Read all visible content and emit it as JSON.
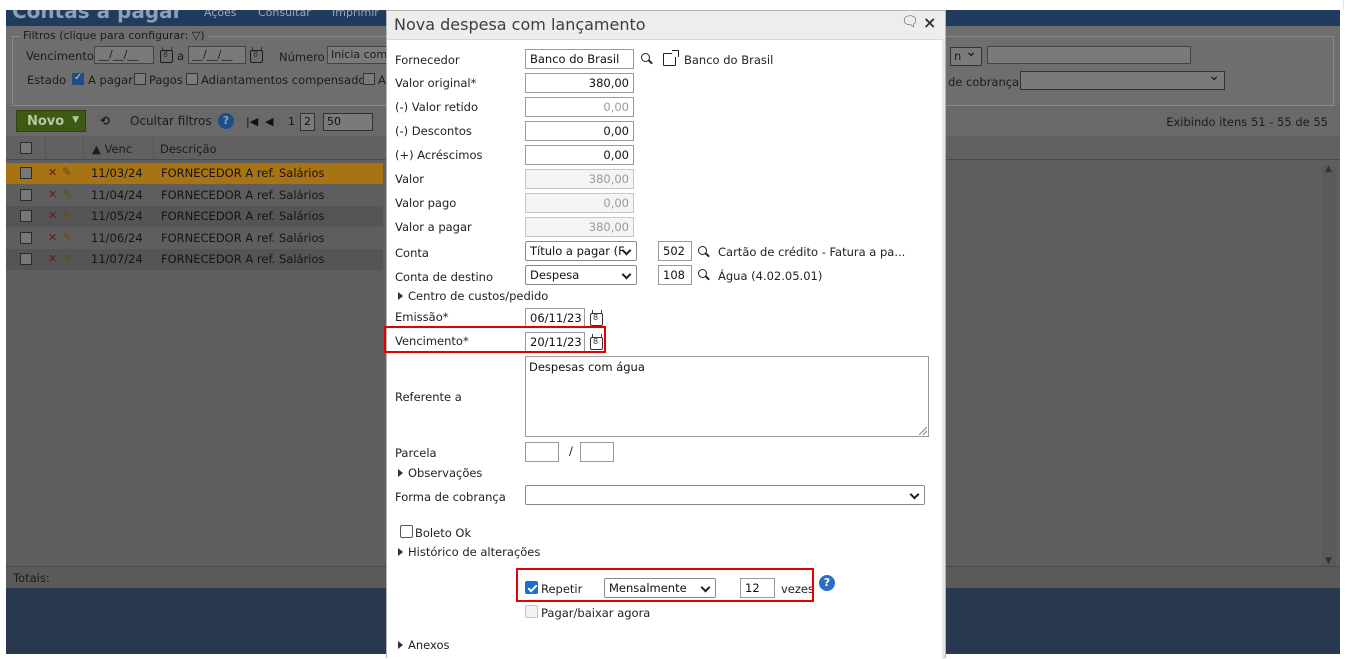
{
  "background": {
    "title": "Contas a pagar",
    "menu": [
      "Ações",
      "Consultar",
      "Imprimir"
    ],
    "filters": {
      "legend": "Filtros (clique para configurar:",
      "vencimento_label": "Vencimento",
      "date_placeholder": "__/__/__",
      "a_label": "a",
      "numero_label": "Número",
      "numero_value": "Inicia com",
      "estado_label": "Estado",
      "a_pagar": "A pagar",
      "pagos": "Pagos",
      "adiantamentos": "Adiantamentos compensados",
      "cut_a": "A",
      "select_right_value": "n",
      "forma_cobranca_partial": "de cobrança"
    },
    "toolbar": {
      "novo": "Novo",
      "ocultar_filtros": "Ocultar filtros",
      "help": "?",
      "page1": "1",
      "page2": "2",
      "page_size": "50",
      "showing": "Exibindo itens 51 - 55 de 55"
    },
    "grid": {
      "headers": {
        "venc": "▲ Venc",
        "descricao": "Descrição"
      },
      "rows": [
        {
          "venc": "11/03/24",
          "desc": "FORNECEDOR A ref. Salários"
        },
        {
          "venc": "11/04/24",
          "desc": "FORNECEDOR A ref. Salários"
        },
        {
          "venc": "11/05/24",
          "desc": "FORNECEDOR A ref. Salários"
        },
        {
          "venc": "11/06/24",
          "desc": "FORNECEDOR A ref. Salários"
        },
        {
          "venc": "11/07/24",
          "desc": "FORNECEDOR A ref. Salários"
        }
      ],
      "totais": "Totais:"
    }
  },
  "dialog": {
    "title": "Nova despesa com lançamento",
    "close": "×",
    "fornecedor": {
      "label": "Fornecedor",
      "value": "Banco do Brasil",
      "display": "Banco do Brasil"
    },
    "valor_original": {
      "label": "Valor original*",
      "value": "380,00"
    },
    "valor_retido": {
      "label": "(-) Valor retido",
      "value": "0,00"
    },
    "descontos": {
      "label": "(-) Descontos",
      "value": "0,00"
    },
    "acrescimos": {
      "label": "(+) Acréscimos",
      "value": "0,00"
    },
    "valor": {
      "label": "Valor",
      "value": "380,00"
    },
    "valor_pago": {
      "label": "Valor pago",
      "value": "0,00"
    },
    "valor_a_pagar": {
      "label": "Valor a pagar",
      "value": "380,00"
    },
    "conta": {
      "label": "Conta",
      "select": "Título a pagar (F",
      "code": "502",
      "desc": "Cartão de crédito - Fatura a pa..."
    },
    "conta_destino": {
      "label": "Conta de destino",
      "select": "Despesa",
      "code": "108",
      "desc": "Água (4.02.05.01)"
    },
    "centro_custos": "Centro de custos/pedido",
    "emissao": {
      "label": "Emissão*",
      "value": "06/11/23"
    },
    "vencimento": {
      "label": "Vencimento*",
      "value": "20/11/23"
    },
    "referente": {
      "label": "Referente a",
      "value": "Despesas com água"
    },
    "parcela": {
      "label": "Parcela",
      "sep": "/"
    },
    "observacoes": "Observações",
    "forma_cobranca": {
      "label": "Forma de cobrança",
      "value": ""
    },
    "boleto_ok": "Boleto Ok",
    "historico": "Histórico de alterações",
    "repetir": {
      "label": "Repetir",
      "freq": "Mensalmente",
      "times": "12",
      "vezes": "vezes"
    },
    "pagar_baixar": "Pagar/baixar agora",
    "anexos": "Anexos",
    "help": "?"
  },
  "colors": {
    "highlight": "#e30000",
    "accent": "#1a6dd1",
    "row_selected": "#a87312"
  }
}
